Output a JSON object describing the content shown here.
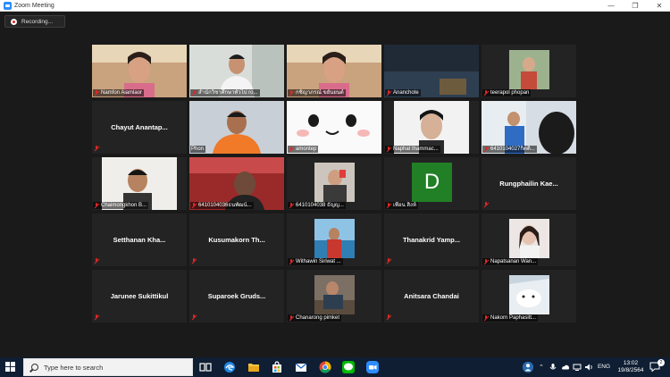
{
  "window": {
    "title": "Zoom Meeting",
    "controls": {
      "minimize": "—",
      "maximize": "❐",
      "close": "✕"
    }
  },
  "recording": {
    "label": "Recording..."
  },
  "accent": {
    "active_speaker": "#a6d13a",
    "muted_mic": "#e02828",
    "avatar_d": "#217f25"
  },
  "participants": [
    {
      "label": "Namfon Aiamlaor",
      "muted": true,
      "video": "full",
      "scene": "girl"
    },
    {
      "label": "สำนักวิชาศึกษาทั่วไป ro...",
      "muted": true,
      "video": "full",
      "scene": "host"
    },
    {
      "label": "กชิญาภรณ์ ขยันยนต์",
      "muted": true,
      "video": "full",
      "scene": "girl"
    },
    {
      "label": "Ananchote",
      "muted": true,
      "video": "full",
      "scene": "dark"
    },
    {
      "label": "teerapol phopan",
      "muted": true,
      "video": "small",
      "scene": "child"
    },
    {
      "label": "",
      "center": "Chayut Anantap...",
      "muted": true,
      "video": "none"
    },
    {
      "label": "Phon",
      "muted": false,
      "video": "full",
      "scene": "orange",
      "active": true
    },
    {
      "label": "amontep",
      "muted": true,
      "video": "full",
      "scene": "cartoon"
    },
    {
      "label": "Naphat thammac...",
      "muted": true,
      "video": "mid",
      "scene": "boy"
    },
    {
      "label": "6410104027กิตติ...",
      "muted": true,
      "video": "full",
      "scene": "blue"
    },
    {
      "label": "Chaimongkhon B...",
      "muted": true,
      "video": "mid",
      "scene": "room"
    },
    {
      "label": "6410104036ธนพัฒน์...",
      "muted": true,
      "video": "full",
      "scene": "red"
    },
    {
      "label": "6410104038 ธัญญ...",
      "muted": true,
      "video": "small",
      "scene": "selfie"
    },
    {
      "label": "เพื่อน สิงห์",
      "muted": true,
      "video": "avatar",
      "avatar": "D"
    },
    {
      "label": "",
      "center": "Rungphailin Kae...",
      "muted": true,
      "video": "none"
    },
    {
      "label": "",
      "center": "Setthanan Kha...",
      "muted": true,
      "video": "none"
    },
    {
      "label": "",
      "center": "Kusumakorn Th...",
      "muted": true,
      "video": "none"
    },
    {
      "label": "Withawin Siriwat ...",
      "muted": true,
      "video": "small",
      "scene": "beach"
    },
    {
      "label": "",
      "center": "Thanakrid Yamp...",
      "muted": true,
      "video": "none"
    },
    {
      "label": "Napatsanan Wan...",
      "muted": true,
      "video": "small",
      "scene": "portrait"
    },
    {
      "label": "",
      "center": "Jarunee Sukittikul",
      "muted": true,
      "video": "none"
    },
    {
      "label": "",
      "center": "Suparoek Gruds...",
      "muted": true,
      "video": "none"
    },
    {
      "label": "Chanarong pimket",
      "muted": true,
      "video": "small",
      "scene": "desk"
    },
    {
      "label": "",
      "center": "Anitsara Chandai",
      "muted": true,
      "video": "none"
    },
    {
      "label": "Nakorn Paphasitt...",
      "muted": true,
      "video": "small",
      "scene": "snow"
    }
  ],
  "taskbar": {
    "search_placeholder": "Type here to search",
    "apps": [
      "task-view-icon",
      "edge-icon",
      "file-explorer-icon",
      "store-icon",
      "mail-icon",
      "chrome-icon",
      "line-icon",
      "zoom-icon"
    ],
    "language": "ENG",
    "time": "13:02",
    "date": "19/8/2564",
    "notification_count": "2"
  }
}
